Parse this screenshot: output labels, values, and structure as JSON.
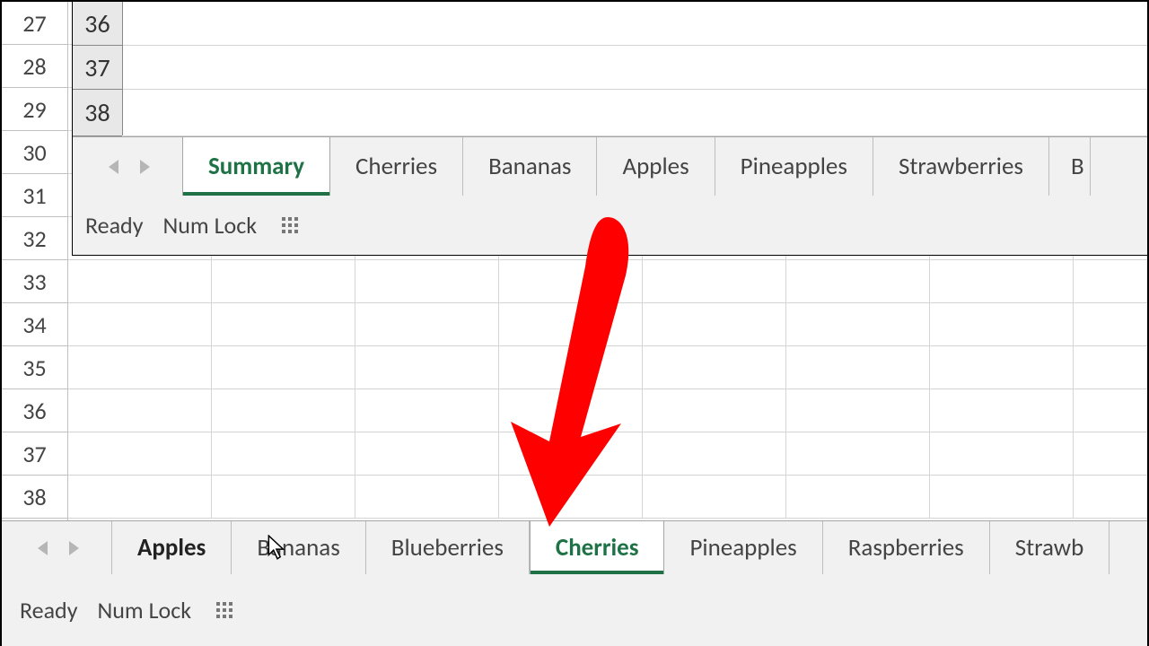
{
  "background": {
    "row_headers": [
      "27",
      "28",
      "29",
      "30",
      "31",
      "32",
      "33",
      "34",
      "35",
      "36",
      "37",
      "38"
    ]
  },
  "inset": {
    "row_headers": [
      "36",
      "37",
      "38"
    ],
    "tabs": [
      {
        "label": "Summary",
        "active": true
      },
      {
        "label": "Cherries",
        "active": false
      },
      {
        "label": "Bananas",
        "active": false
      },
      {
        "label": "Apples",
        "active": false
      },
      {
        "label": "Pineapples",
        "active": false
      },
      {
        "label": "Strawberries",
        "active": false
      },
      {
        "label": "B",
        "active": false
      }
    ],
    "status": {
      "ready": "Ready",
      "numlock": "Num Lock"
    }
  },
  "outer": {
    "tabs": [
      {
        "label": "Apples",
        "bold": true,
        "active": false
      },
      {
        "label": "Bananas",
        "bold": false,
        "active": false
      },
      {
        "label": "Blueberries",
        "bold": false,
        "active": false
      },
      {
        "label": "Cherries",
        "bold": false,
        "active": true
      },
      {
        "label": "Pineapples",
        "bold": false,
        "active": false
      },
      {
        "label": "Raspberries",
        "bold": false,
        "active": false
      },
      {
        "label": "Strawb",
        "bold": false,
        "active": false
      }
    ],
    "status": {
      "ready": "Ready",
      "numlock": "Num Lock"
    }
  }
}
